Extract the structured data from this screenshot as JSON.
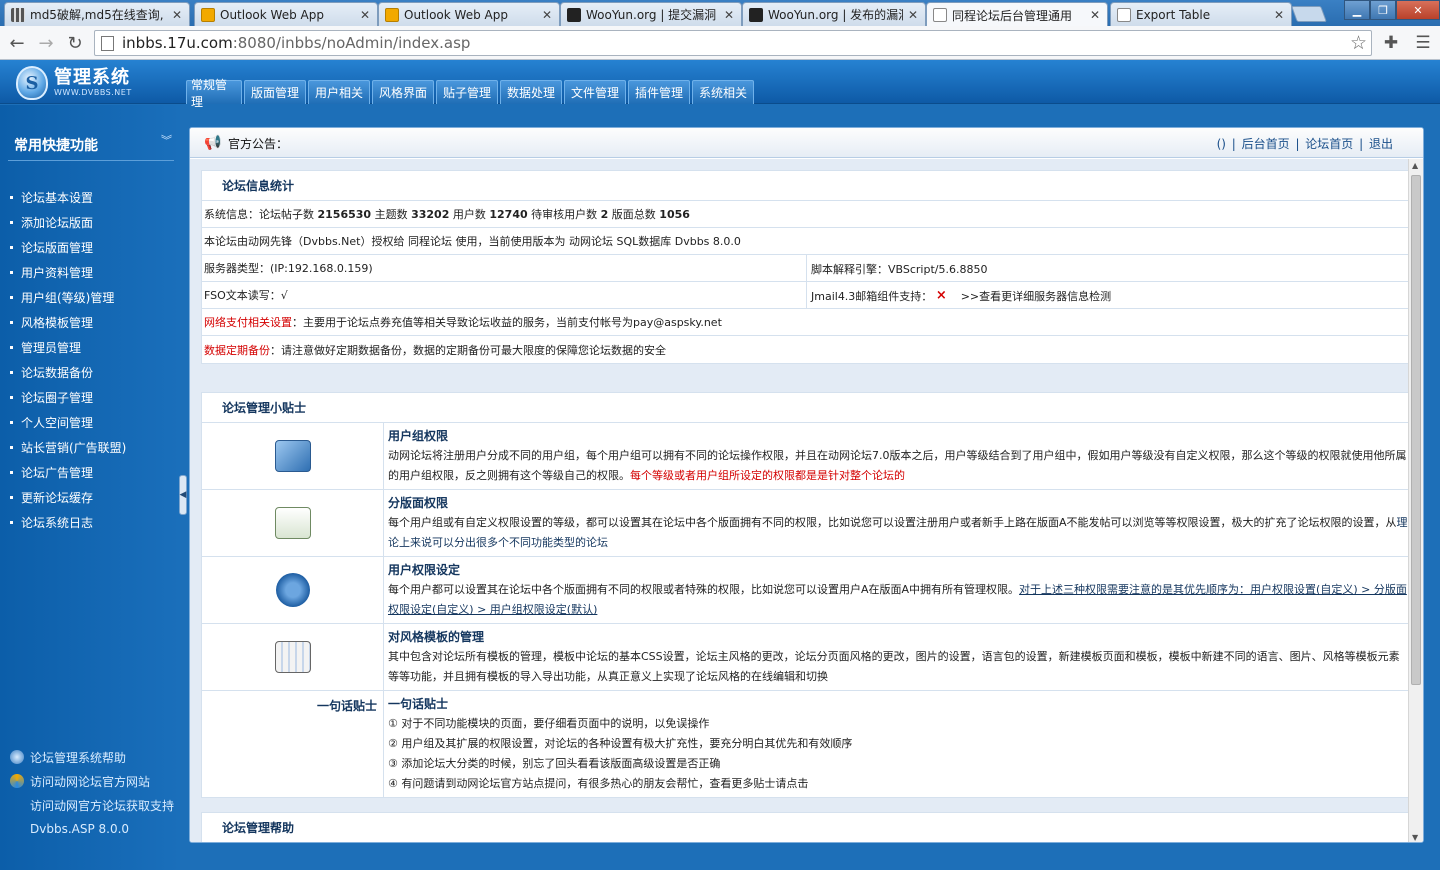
{
  "browser": {
    "tabs": [
      {
        "title": "md5破解,md5在线查询,",
        "active": false
      },
      {
        "title": "Outlook Web App",
        "active": false
      },
      {
        "title": "Outlook Web App",
        "active": false
      },
      {
        "title": "WooYun.org | 提交漏洞",
        "active": false
      },
      {
        "title": "WooYun.org | 发布的漏洞",
        "active": false
      },
      {
        "title": "同程论坛后台管理通用",
        "active": true
      },
      {
        "title": "Export Table",
        "active": false
      }
    ],
    "url_host": "inbbs.17u.com",
    "url_path": ":8080/inbbs/noAdmin/index.asp"
  },
  "header": {
    "logo_title": "管理系统",
    "logo_sub": "WWW.DVBBS.NET",
    "nav": [
      "常规管理",
      "版面管理",
      "用户相关",
      "风格界面",
      "贴子管理",
      "数据处理",
      "文件管理",
      "插件管理",
      "系统相关"
    ]
  },
  "sidebar": {
    "title": "常用快捷功能",
    "items": [
      "论坛基本设置",
      "添加论坛版面",
      "论坛版面管理",
      "用户资料管理",
      "用户组(等级)管理",
      "风格模板管理",
      "管理员管理",
      "论坛数据备份",
      "论坛圈子管理",
      "个人空间管理",
      "站长营销(广告联盟)",
      "论坛广告管理",
      "更新论坛缓存",
      "论坛系统日志"
    ],
    "bottom": [
      "论坛管理系统帮助",
      "访问动网论坛官方网站",
      "访问动网官方论坛获取支持",
      "Dvbbs.ASP 8.0.0"
    ]
  },
  "notice": {
    "label": "官方公告：",
    "links": [
      "()",
      "后台首页",
      "论坛首页",
      "退出"
    ]
  },
  "stats": {
    "title": "论坛信息统计",
    "sys_prefix": "系统信息：论坛帖子数",
    "posts": "2156530",
    "topics_label": "主题数",
    "topics": "33202",
    "users_label": "用户数",
    "users": "12740",
    "pending_label": "待审核用户数",
    "pending": "2",
    "boards_label": "版面总数",
    "boards": "1056",
    "license": "本论坛由动网先锋（Dvbbs.Net）授权给 同程论坛 使用，当前使用版本为 动网论坛 SQL数据库 Dvbbs 8.0.0",
    "server": "服务器类型：(IP:192.168.0.159)",
    "script": "脚本解释引擎：VBScript/5.6.8850",
    "fso": "FSO文本读写：√",
    "jmail": "Jmail4.3邮箱组件支持：",
    "jmail_mark": "×",
    "detect": ">>查看更详细服务器信息检测",
    "pay_label": "网络支付相关设置",
    "pay_text": "：主要用于论坛点券充值等相关导致论坛收益的服务，当前支付帐号为pay@aspsky.net",
    "backup_label": "数据定期备份",
    "backup_text": "：请注意做好定期数据备份，数据的定期备份可最大限度的保障您论坛数据的安全"
  },
  "tips": {
    "title": "论坛管理小贴士",
    "items": [
      {
        "icon": "user-group-icon",
        "title": "用户组权限",
        "text": "动网论坛将注册用户分成不同的用户组，每个用户组可以拥有不同的论坛操作权限，并且在动网论坛7.0版本之后，用户等级结合到了用户组中，假如用户等级没有自定义权限，那么这个等级的权限就使用他所属的用户组权限，反之则拥有这个等级自己的权限。",
        "highlight": "每个等级或者用户组所设定的权限都是是针对整个论坛的"
      },
      {
        "icon": "board-permission-icon",
        "title": "分版面权限",
        "text": "每个用户组或有自定义权限设置的等级，都可以设置其在论坛中各个版面拥有不同的权限，比如说您可以设置注册用户或者新手上路在版面A不能发帖可以浏览等等权限设置，极大的扩充了论坛权限的设置，从",
        "highlight": "理论上来说可以分出很多个不同功能类型的论坛"
      },
      {
        "icon": "gear-user-icon",
        "title": "用户权限设定",
        "text": "每个用户都可以设置其在论坛中各个版面拥有不同的权限或者特殊的权限，比如说您可以设置用户A在版面A中拥有所有管理权限。",
        "highlight": "对于上述三种权限需要注意的是其优先顺序为：用户权限设置(自定义) > 分版面权限设定(自定义) > 用户组权限设定(默认)"
      },
      {
        "icon": "style-template-icon",
        "title": "对风格模板的管理",
        "text": "其中包含对论坛所有模板的管理，模板中论坛的基本CSS设置，论坛主风格的更改，论坛分页面风格的更改，图片的设置，语言包的设置，新建模板页面和模板，模板中新建不同的语言、图片、风格等模板元素等等功能，并且拥有模板的导入导出功能，从真正意义上实现了论坛风格的在线编辑和切换",
        "highlight": ""
      }
    ],
    "oneline_label": "一句话贴士",
    "oneline_title": "一句话贴士",
    "oneline": [
      "① 对于不同功能模块的页面，要仔细看页面中的说明，以免误操作",
      "② 用户组及其扩展的权限设置，对论坛的各种设置有极大扩充性，要充分明白其优先和有效顺序",
      "③ 添加论坛大分类的时候，别忘了回头看看该版面高级设置是否正确",
      "④ 有问题请到动网论坛官方站点提问，有很多热心的朋友会帮忙，查看更多贴士请点击"
    ]
  },
  "help": {
    "title": "论坛管理帮助"
  }
}
